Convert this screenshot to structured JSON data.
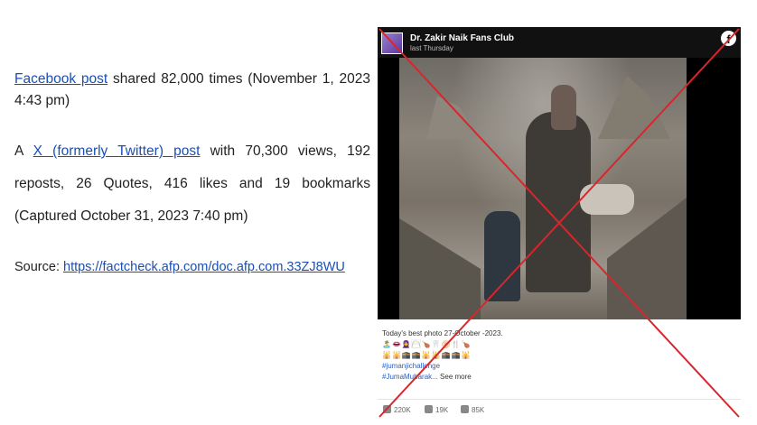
{
  "doc": {
    "p1": {
      "link": "Facebook post",
      "text": " shared 82,000 times (November 1, 2023 4:43 pm)"
    },
    "p2": {
      "prefix": "A ",
      "link": "X (formerly Twitter) post",
      "text": " with 70,300 views, 192 reposts, 26 Quotes, 416 likes and 19 bookmarks (Captured October 31, 2023 7:40 pm)"
    },
    "source": {
      "label": "Source: ",
      "url": "https://factcheck.afp.com/doc.afp.com.33ZJ8WU"
    }
  },
  "post": {
    "page_name": "Dr. Zakir Naik Fans Club",
    "time": "last Thursday",
    "fb_icon": "f",
    "caption": "Today's best photo 27-October -2023.",
    "emoji_line1": "🏝️👄🧕🦳🍗🦷🫓🍴🍗",
    "emoji_line2": "🕌🕌🕋🕋🕌🕌🕋🕋🕌",
    "hashtag1": "#jumanjichallenge",
    "hashtag2": "#JumaMubarak...",
    "see_more": "See more",
    "reactions": {
      "likes": "220K",
      "comments": "19K",
      "shares": "85K"
    }
  },
  "colors": {
    "link": "#1a4fb5",
    "cross": "#d7262c"
  }
}
